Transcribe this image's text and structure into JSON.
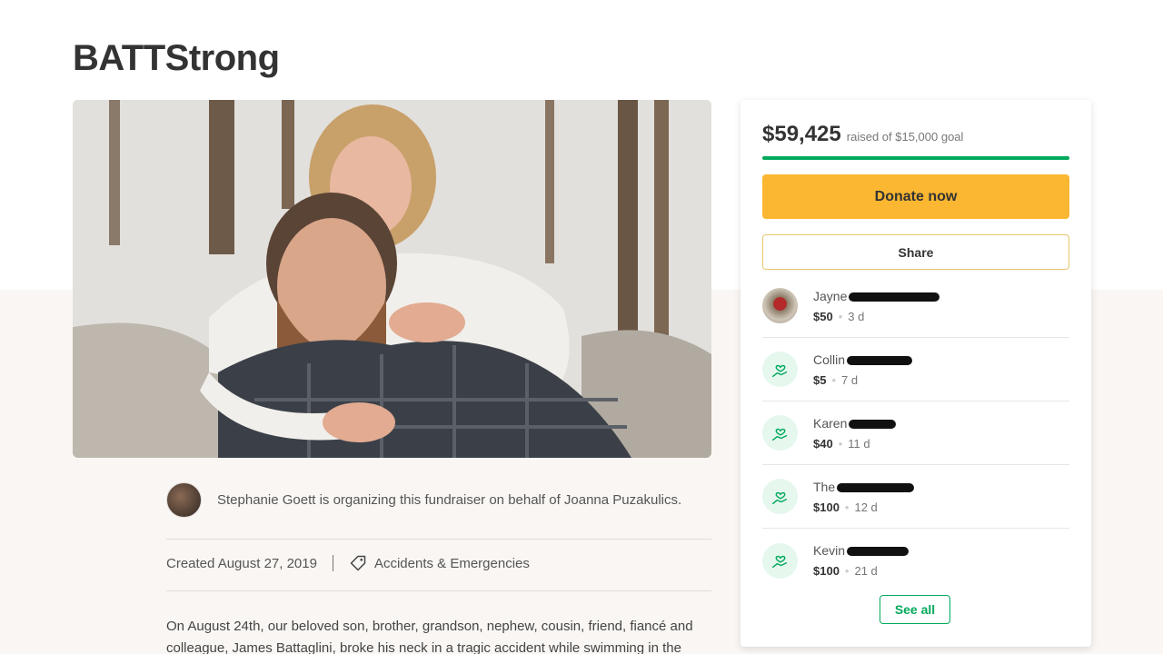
{
  "page": {
    "title": "BATTStrong"
  },
  "organizer": {
    "text": "Stephanie Goett is organizing this fundraiser on behalf of Joanna Puzakulics."
  },
  "meta": {
    "created": "Created August 27, 2019",
    "category": "Accidents & Emergencies"
  },
  "story": {
    "text": "On August 24th, our beloved son, brother, grandson, nephew, cousin, friend, fiancé and colleague, James Battaglini, broke his neck in a tragic accident while swimming in the"
  },
  "donation": {
    "raised": "$59,425",
    "goal_text": "raised of $15,000 goal",
    "progress_fraction": 1.0,
    "donate_label": "Donate now",
    "share_label": "Share",
    "see_all_label": "See all"
  },
  "donors": [
    {
      "name": "Jayne",
      "amount": "$50",
      "time": "3 d",
      "avatar": "photo"
    },
    {
      "name": "Collin",
      "amount": "$5",
      "time": "7 d",
      "avatar": "heart-hand-icon"
    },
    {
      "name": "Karen",
      "amount": "$40",
      "time": "11 d",
      "avatar": "heart-hand-icon"
    },
    {
      "name": "The",
      "amount": "$100",
      "time": "12 d",
      "avatar": "heart-hand-icon"
    },
    {
      "name": "Kevin",
      "amount": "$100",
      "time": "21 d",
      "avatar": "heart-hand-icon"
    }
  ],
  "colors": {
    "accent_green": "#02a95c",
    "donate_yellow": "#fbb731"
  }
}
